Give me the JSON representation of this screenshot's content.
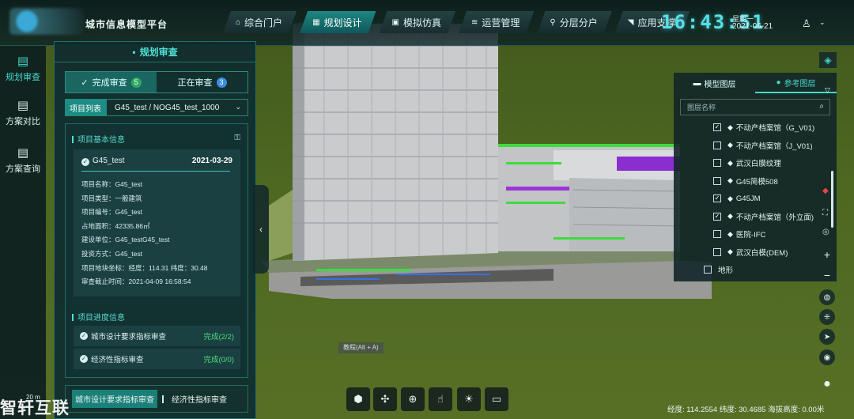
{
  "app": {
    "title": "城市信息模型平台"
  },
  "nav": [
    {
      "label": "综合门户",
      "icon": "home-icon",
      "glyph": "⌂"
    },
    {
      "label": "规划设计",
      "icon": "grid-icon",
      "glyph": "▦"
    },
    {
      "label": "模拟仿真",
      "icon": "cube-icon",
      "glyph": "▣"
    },
    {
      "label": "运营管理",
      "icon": "stack-icon",
      "glyph": "≋"
    },
    {
      "label": "分层分户",
      "icon": "pin-icon",
      "glyph": "⚲"
    },
    {
      "label": "应用支撑",
      "icon": "arrow-icon",
      "glyph": "◥"
    }
  ],
  "header": {
    "time": "16:43:51",
    "weekday": "星期一",
    "date": "2021-06-21"
  },
  "rail": [
    {
      "label": "规划审查",
      "glyph": "▤"
    },
    {
      "label": "方案对比",
      "glyph": "▤"
    },
    {
      "label": "方案查询",
      "glyph": "▤"
    }
  ],
  "panel": {
    "title": "规划审查",
    "tab_done": "完成审查",
    "tab_done_count": "5",
    "tab_progress": "正在审查",
    "tab_progress_count": "3",
    "project_list_label": "项目列表",
    "project_selected": "G45_test / NOG45_test_1000",
    "basic_info_title": "项目基本信息",
    "card": {
      "name": "G45_test",
      "date": "2021-03-29",
      "fields": [
        "项目名称：G45_test",
        "项目类型：一般建筑",
        "项目编号：G45_test",
        "占地面积：42335.86㎡",
        "建设单位：G45_testG45_test",
        "投资方式：G45_test",
        "项目地块坐标：经度：114.31 纬度：30.48",
        "审查截止时间：2021-04-09 16:58:54"
      ]
    },
    "progress_title": "项目进度信息",
    "progress": [
      {
        "label": "城市设计要求指标审查",
        "status": "完成(2/2)"
      },
      {
        "label": "经济性指标审查",
        "status": "完成(0/0)"
      }
    ],
    "bottom_tabs": [
      "城市设计要求指标审查",
      "经济性指标审查"
    ]
  },
  "layers": {
    "tab_model": "模型图层",
    "tab_reference": "参考图层",
    "search_placeholder": "图层名称",
    "items": [
      {
        "label": "不动产档案馆（G_V01)",
        "checked": true
      },
      {
        "label": "不动产档案馆（J_V01)",
        "checked": false
      },
      {
        "label": "武汉白膜纹理",
        "checked": false
      },
      {
        "label": "G45简模508",
        "checked": false
      },
      {
        "label": "G45JM",
        "checked": true
      },
      {
        "label": "不动产档案馆（外立面)",
        "checked": true
      },
      {
        "label": "医院-IFC",
        "checked": false
      },
      {
        "label": "武汉白模(DEM)",
        "checked": false
      },
      {
        "label": "地形",
        "checked": false
      }
    ]
  },
  "scene": {
    "tooltip": "教程(Alt + A)",
    "scale": "20 m"
  },
  "status": {
    "text": "经度: 114.2554 纬度: 30.4685 海拔高度: 0.00米"
  },
  "watermark": "智轩互联",
  "colors": {
    "accent": "#43d8cc",
    "done_badge": "#2ea860",
    "progress_badge": "#3d8ce0",
    "status_ok": "#4fdd7a"
  }
}
